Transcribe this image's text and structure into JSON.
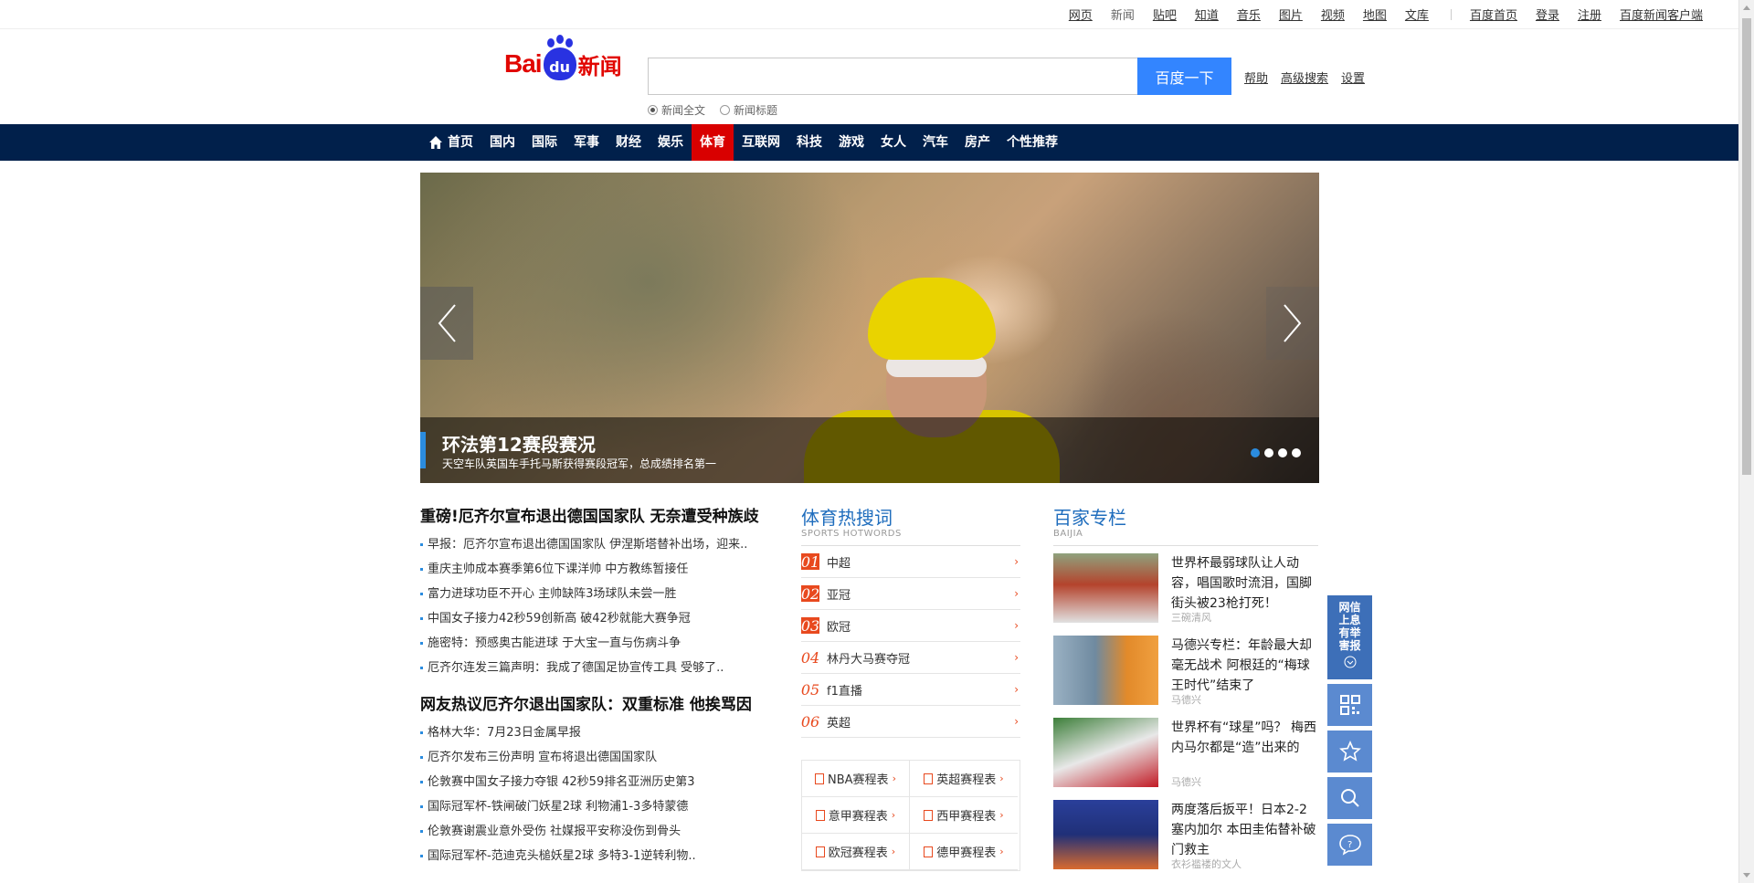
{
  "topbar": {
    "links": [
      "网页",
      "新闻",
      "贴吧",
      "知道",
      "音乐",
      "图片",
      "视频",
      "地图",
      "文库"
    ],
    "right_links": [
      "百度首页",
      "登录",
      "注册",
      "百度新闻客户端"
    ]
  },
  "logo": {
    "bai": "Bai",
    "du": "du",
    "news": "新闻"
  },
  "search": {
    "value": "",
    "button": "百度一下",
    "links": [
      "帮助",
      "高级搜索",
      "设置"
    ],
    "radio_options": [
      "新闻全文",
      "新闻标题"
    ],
    "radio_selected": "新闻全文"
  },
  "nav": {
    "items": [
      "首页",
      "国内",
      "国际",
      "军事",
      "财经",
      "娱乐",
      "体育",
      "互联网",
      "科技",
      "游戏",
      "女人",
      "汽车",
      "房产",
      "个性推荐"
    ],
    "active": "体育"
  },
  "slider": {
    "title": "环法第12赛段赛况",
    "subtitle": "天空车队英国车手托马斯获得赛段冠军，总成绩排名第一",
    "dot_count": 4,
    "active_dot": 1
  },
  "headlines": [
    {
      "title": "重磅!厄齐尔宣布退出德国国家队 无奈遭受种族歧",
      "items": [
        "早报：厄齐尔宣布退出德国国家队 伊涅斯塔替补出场，迎来..",
        "重庆主帅成本赛季第6位下课洋帅 中方教练暂接任",
        "富力进球功臣不开心 主帅缺阵3场球队未尝一胜",
        "中国女子接力42秒59创新高 破42秒就能大赛争冠",
        "施密特：预感奥古能进球 于大宝一直与伤病斗争",
        "厄齐尔连发三篇声明：我成了德国足协宣传工具 受够了.."
      ]
    },
    {
      "title": "网友热议厄齐尔退出国家队：双重标准 他挨骂因",
      "items": [
        "格林大华：7月23日金属早报",
        "厄齐尔发布三份声明 宣布将退出德国国家队",
        "伦敦赛中国女子接力夺银 42秒59排名亚洲历史第3",
        "国际冠军杯-铁闸破门妖星2球 利物浦1-3多特蒙德",
        "伦敦赛谢震业意外受伤 社媒报平安称没伤到骨头",
        "国际冠军杯-范迪克头槌妖星2球 多特3-1逆转利物.."
      ]
    }
  ],
  "hotwords": {
    "title": "体育热搜词",
    "subtitle": "SPORTS HOTWORDS",
    "items": [
      {
        "num": "01",
        "text": "中超"
      },
      {
        "num": "02",
        "text": "亚冠"
      },
      {
        "num": "03",
        "text": "欧冠"
      },
      {
        "num": "04",
        "text": "林丹大马赛夺冠"
      },
      {
        "num": "05",
        "text": "f1直播"
      },
      {
        "num": "06",
        "text": "英超"
      }
    ],
    "schedules": [
      "NBA赛程表",
      "英超赛程表",
      "意甲赛程表",
      "西甲赛程表",
      "欧冠赛程表",
      "德甲赛程表"
    ]
  },
  "baijia": {
    "title": "百家专栏",
    "subtitle": "BAIJIA",
    "items": [
      {
        "text": "世界杯最弱球队让人动容，唱国歌时流泪，国脚街头被23枪打死！",
        "author": "三碗清风"
      },
      {
        "text": "马德兴专栏：年龄最大却毫无战术 阿根廷的“梅球王时代”结束了",
        "author": "马德兴"
      },
      {
        "text": "世界杯有“球星”吗？ 梅西内马尔都是“造”出来的",
        "author": "马德兴"
      },
      {
        "text": "两度落后扳平！日本2-2塞内加尔 本田圭佑替补破门救主",
        "author": "衣衫褴褛的文人"
      }
    ]
  },
  "sidebar": {
    "report_label": "网信上息有举害报",
    "buttons": [
      "qr-code-icon",
      "star-icon",
      "search-icon",
      "help-icon"
    ]
  },
  "colors": {
    "nav_bg": "#01204b",
    "nav_active": "#d90000",
    "search_button": "#3385ff",
    "accent_blue": "#1f6dbd",
    "hot_orange": "#e8491e"
  }
}
